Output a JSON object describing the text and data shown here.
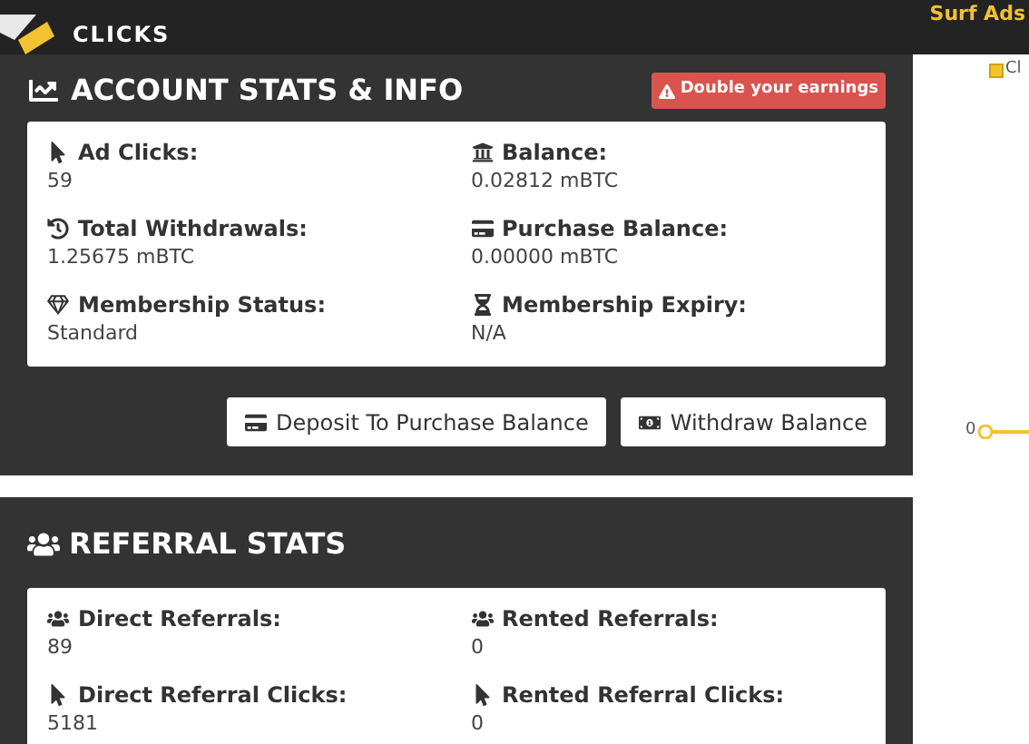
{
  "header": {
    "logo_text": "CLICKS",
    "nav_link": "Surf Ads"
  },
  "account": {
    "title": "ACCOUNT STATS & INFO",
    "badge": "Double your earnings",
    "stats": [
      {
        "kind": "pointer",
        "label": "Ad Clicks:",
        "value": "59"
      },
      {
        "kind": "bank",
        "label": "Balance:",
        "value": "0.02812 mBTC"
      },
      {
        "kind": "history",
        "label": "Total Withdrawals:",
        "value": "1.25675 mBTC"
      },
      {
        "kind": "card",
        "label": "Purchase Balance:",
        "value": "0.00000 mBTC"
      },
      {
        "kind": "gem",
        "label": "Membership Status:",
        "value": "Standard"
      },
      {
        "kind": "hourglass",
        "label": "Membership Expiry:",
        "value": "N/A"
      }
    ],
    "buttons": [
      {
        "kind": "card",
        "label": "Deposit To Purchase Balance"
      },
      {
        "kind": "money",
        "label": "Withdraw Balance"
      }
    ]
  },
  "side_chart": {
    "legend": "Cl",
    "tick": "0"
  },
  "referral": {
    "title": "REFERRAL STATS",
    "stats": [
      {
        "kind": "users",
        "label": "Direct Referrals:",
        "value": "89"
      },
      {
        "kind": "users",
        "label": "Rented Referrals:",
        "value": "0"
      },
      {
        "kind": "pointer",
        "label": "Direct Referral Clicks:",
        "value": "5181"
      },
      {
        "kind": "pointer",
        "label": "Rented Referral Clicks:",
        "value": "0"
      }
    ]
  }
}
